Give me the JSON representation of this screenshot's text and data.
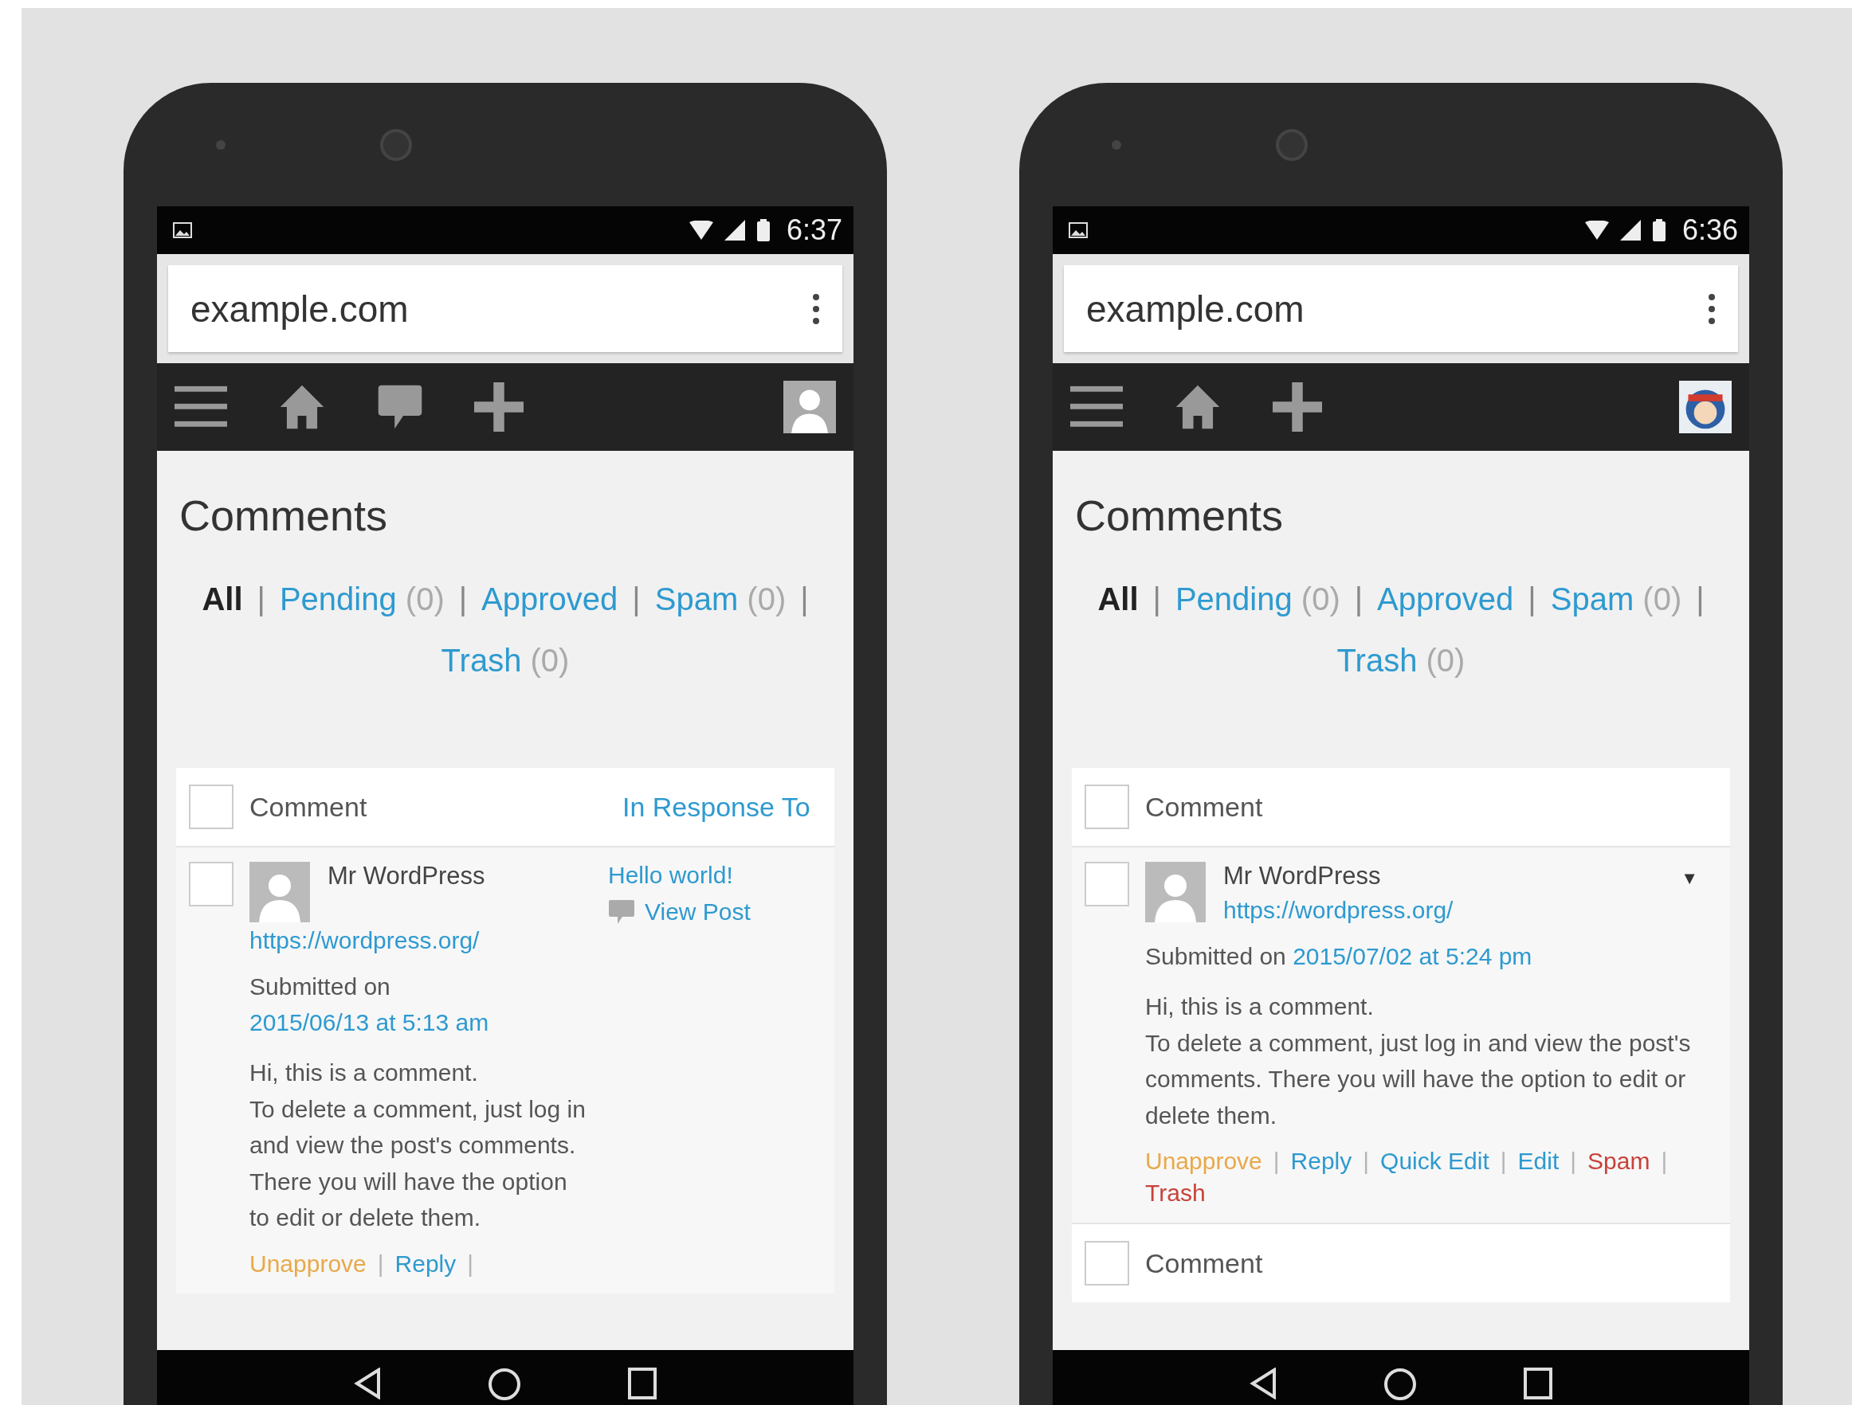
{
  "phones": [
    {
      "status_time": "6:37",
      "url": "example.com",
      "toolbar": [
        {
          "kind": "menu"
        },
        {
          "kind": "home"
        },
        {
          "kind": "comments"
        },
        {
          "kind": "new"
        },
        {
          "kind": "avatar-default"
        }
      ],
      "page_title": "Comments",
      "filters": [
        {
          "label": "All",
          "selected": true,
          "separator": "|"
        },
        {
          "label": "Pending",
          "count": "(0)",
          "selected": false,
          "separator": "|"
        },
        {
          "label": "Approved",
          "selected": false,
          "separator": "|"
        },
        {
          "label": "Spam",
          "count": "(0)",
          "selected": false,
          "separator": "|"
        },
        {
          "label": "Trash",
          "count": "(0)",
          "selected": false
        }
      ],
      "table": {
        "select_all_checked": false,
        "column_comment": "Comment",
        "column_response": "In Response To",
        "rows": [
          {
            "checked": false,
            "author": "Mr WordPress",
            "author_url": "https://wordpress.org/",
            "submitted_label": "Submitted on",
            "date": "2015/06/13 at 5:13 am",
            "body": [
              "Hi, this is a comment.",
              "To delete a comment, just log in and view the post's comments. There you will have the option to edit or delete them."
            ],
            "response": {
              "post": "Hello world!",
              "view": "View Post"
            },
            "actions": [
              {
                "label": "Unapprove",
                "kind": "warning",
                "separator": "|"
              },
              {
                "label": "Reply",
                "kind": "link",
                "separator": "|"
              }
            ]
          }
        ]
      }
    },
    {
      "status_time": "6:36",
      "url": "example.com",
      "toolbar": [
        {
          "kind": "menu"
        },
        {
          "kind": "home"
        },
        {
          "kind": "new"
        },
        {
          "kind": "avatar-image"
        }
      ],
      "page_title": "Comments",
      "filters": [
        {
          "label": "All",
          "selected": true,
          "separator": "|"
        },
        {
          "label": "Pending",
          "count": "(0)",
          "selected": false,
          "separator": "|"
        },
        {
          "label": "Approved",
          "selected": false,
          "separator": "|"
        },
        {
          "label": "Spam",
          "count": "(0)",
          "selected": false,
          "separator": "|"
        },
        {
          "label": "Trash",
          "count": "(0)",
          "selected": false
        }
      ],
      "table": {
        "select_all_checked": false,
        "column_comment": "Comment",
        "rows": [
          {
            "checked": false,
            "author": "Mr WordPress",
            "author_url": "https://wordpress.org/",
            "submitted_label": "Submitted on",
            "date": "2015/07/02 at 5:24 pm",
            "toggle_icon": "▼",
            "body": [
              "Hi, this is a comment.",
              "To delete a comment, just log in and view the post's comments. There you will have the option to edit or delete them."
            ],
            "actions": [
              {
                "label": "Unapprove",
                "kind": "warning",
                "separator": "|"
              },
              {
                "label": "Reply",
                "kind": "link",
                "separator": "|"
              },
              {
                "label": "Quick Edit",
                "kind": "link",
                "separator": "|"
              },
              {
                "label": "Edit",
                "kind": "link",
                "separator": "|"
              },
              {
                "label": "Spam",
                "kind": "danger",
                "separator": "|"
              },
              {
                "label": "Trash",
                "kind": "danger"
              }
            ]
          }
        ],
        "footer": {
          "label": "Comment",
          "checked": false
        }
      }
    }
  ]
}
